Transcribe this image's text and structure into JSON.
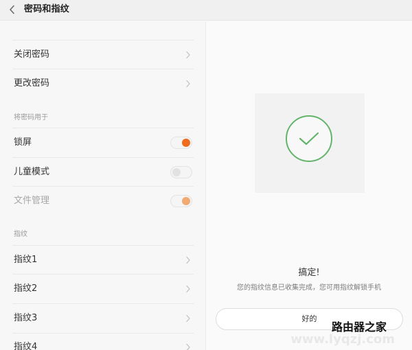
{
  "header": {
    "title": "密码和指纹",
    "back_icon": "chevron-left-icon"
  },
  "left": {
    "password_rows": [
      {
        "label": "关闭密码"
      },
      {
        "label": "更改密码"
      }
    ],
    "use_password_section": "将密码用于",
    "use_rows": [
      {
        "label": "锁屏",
        "state": "on"
      },
      {
        "label": "儿童模式",
        "state": "off"
      },
      {
        "label": "文件管理",
        "state": "on-dim"
      }
    ],
    "fingerprint_section": "指纹",
    "fingerprints": [
      {
        "label": "指纹1"
      },
      {
        "label": "指纹2"
      },
      {
        "label": "指纹3"
      },
      {
        "label": "指纹4"
      }
    ]
  },
  "right": {
    "success_icon": "check-circle-icon",
    "done_title": "搞定!",
    "done_subtitle": "您的指纹信息已收集完成，您可用指纹解锁手机",
    "ok_label": "好的"
  },
  "watermark": {
    "text": "路由器之家 www.lyqzj.com"
  },
  "colors": {
    "accent": "#f06b1e",
    "accent_dim": "#f2aa73",
    "success": "#63b46b",
    "divider": "#e8e8e8",
    "text_primary": "#333333",
    "text_secondary": "#9a9a9a"
  }
}
